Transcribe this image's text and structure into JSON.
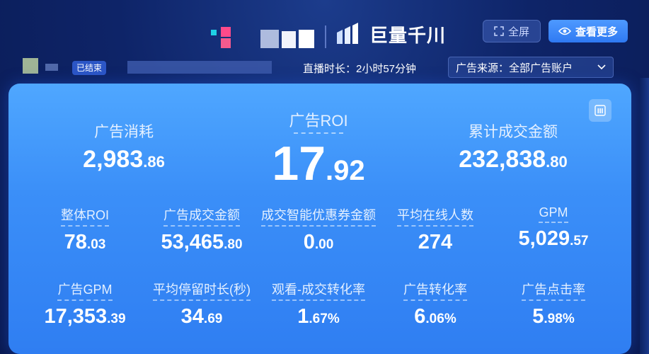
{
  "header": {
    "brand_name": "巨量千川",
    "fullscreen_label": "全屏",
    "view_more_label": "查看更多"
  },
  "info": {
    "status_badge": "已结束",
    "live_duration": "直播时长：2小时57分钟",
    "ad_source": "广告来源：全部广告账户"
  },
  "top_metrics": [
    {
      "label": "广告消耗",
      "int": "2,983",
      "dec": ".86"
    },
    {
      "label": "广告ROI",
      "int": "17",
      "dec": ".92"
    },
    {
      "label": "累计成交金额",
      "int": "232,838",
      "dec": ".80"
    }
  ],
  "row1": [
    {
      "label": "整体ROI",
      "int": "78",
      "dec": ".03"
    },
    {
      "label": "广告成交金额",
      "int": "53,465",
      "dec": ".80"
    },
    {
      "label": "成交智能优惠券金额",
      "int": "0",
      "dec": ".00"
    },
    {
      "label": "平均在线人数",
      "int": "274",
      "dec": ""
    },
    {
      "label": "GPM",
      "int": "5,029",
      "dec": ".57"
    }
  ],
  "row2": [
    {
      "label": "广告GPM",
      "int": "17,353",
      "dec": ".39"
    },
    {
      "label": "平均停留时长(秒)",
      "int": "34",
      "dec": ".69"
    },
    {
      "label": "观看-成交转化率",
      "int": "1",
      "dec": ".67%"
    },
    {
      "label": "广告转化率",
      "int": "6",
      "dec": ".06%"
    },
    {
      "label": "广告点击率",
      "int": "5",
      "dec": ".98%"
    }
  ],
  "colors": {
    "background": "#0e2468",
    "card": "#3b8ff8",
    "primary_button": "#2f79f2"
  }
}
